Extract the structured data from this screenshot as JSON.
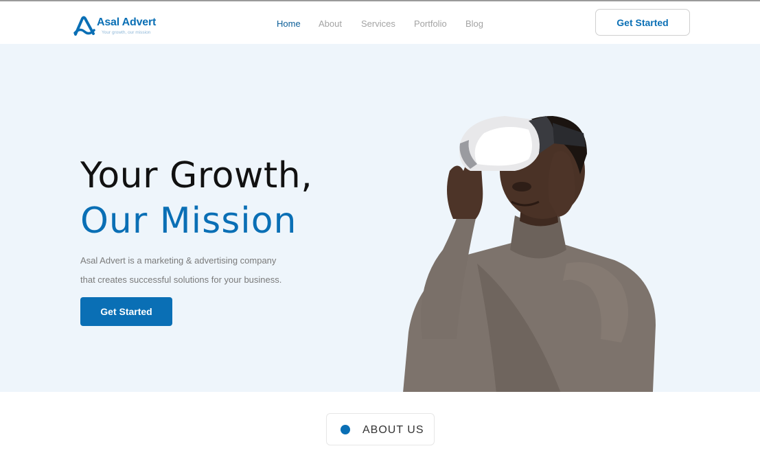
{
  "brand": {
    "name": "Asal Advert",
    "tagline": "Your growth, our mission",
    "accent_color": "#0a6fb5",
    "hero_bg_color": "#eef5fb"
  },
  "nav": {
    "items": [
      {
        "label": "Home",
        "active": true
      },
      {
        "label": "About",
        "active": false
      },
      {
        "label": "Services",
        "active": false
      },
      {
        "label": "Portfolio",
        "active": false
      },
      {
        "label": "Blog",
        "active": false
      }
    ],
    "cta_label": "Get Started"
  },
  "hero": {
    "title_line1": "Your Growth,",
    "title_line2": "Our Mission",
    "description_line1": "Asal Advert is a marketing & advertising company",
    "description_line2": "that creates successful solutions for your business.",
    "cta_label": "Get Started",
    "image_subject": "man-wearing-vr-headset"
  },
  "about": {
    "label": "ABOUT US"
  }
}
